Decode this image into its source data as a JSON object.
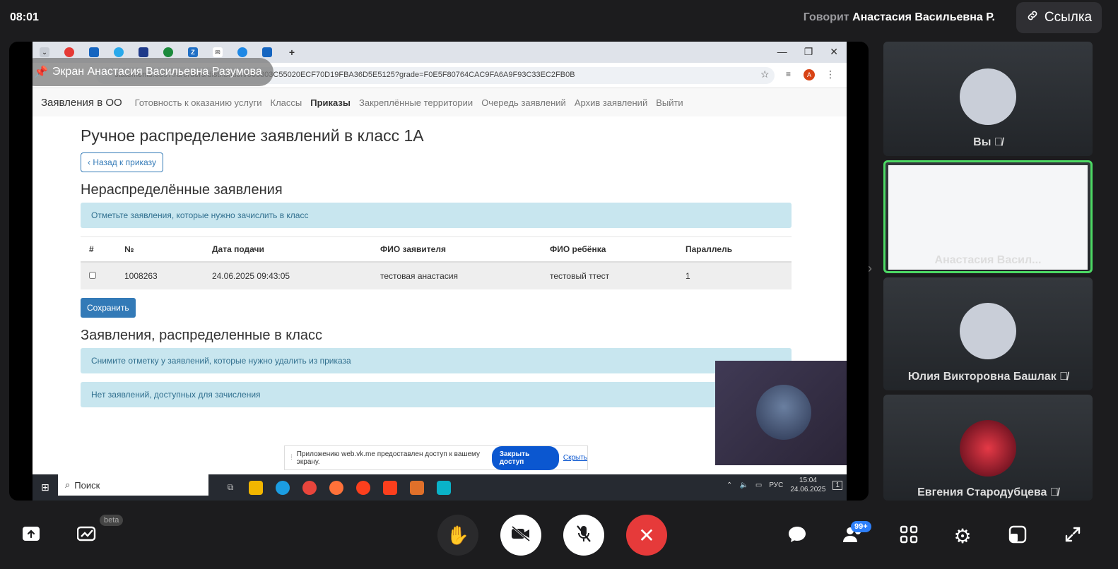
{
  "top": {
    "clock": "08:01",
    "speaker_prefix": "Говорит",
    "speaker_name": "Анастасия Васильевна Р.",
    "link_label": "Ссылка"
  },
  "shared_screen": {
    "label": "Экран Анастасия Васильевна Разумова",
    "url": "statements.ob57.ru/orders/distribution/065803C55020ECF70D19FBA36D5E5125?grade=F0E5F80764CAC9FA6A9F93C33EC2FB0B",
    "profile_initial": "A",
    "navbar": {
      "brand": "Заявления в ОО",
      "items": [
        "Готовность к оказанию услуги",
        "Классы",
        "Приказы",
        "Закреплённые территории",
        "Очередь заявлений",
        "Архив заявлений",
        "Выйти"
      ],
      "active_index": 2
    },
    "page": {
      "title": "Ручное распределение заявлений в класс 1А",
      "back_label": "Назад к приказу",
      "section1_title": "Нераспределённые заявления",
      "section1_alert": "Отметьте заявления, которые нужно зачислить в класс",
      "table": {
        "headers": [
          "#",
          "№",
          "Дата подачи",
          "ФИО заявителя",
          "ФИО ребёнка",
          "Параллель"
        ],
        "rows": [
          [
            "",
            "1008263",
            "24.06.2025 09:43:05",
            "тестовая анастасия",
            "тестовый ттест",
            "1"
          ]
        ]
      },
      "save_label": "Сохранить",
      "section2_title": "Заявления, распределенные в класс",
      "section2_alert": "Снимите отметку у заявлений, которые нужно удалить из приказа",
      "section2_empty": "Нет заявлений, доступных для зачисления"
    },
    "share_bar": {
      "text": "Приложению web.vk.me предоставлен доступ к вашему экрану.",
      "close_label": "Закрыть доступ",
      "hide_label": "Скрыть"
    },
    "taskbar": {
      "search_label": "Поиск",
      "lang": "РУС",
      "time": "15:04",
      "date": "24.06.2025",
      "notif_count": "1"
    }
  },
  "participants": [
    {
      "name": "Вы",
      "muted": true
    },
    {
      "name": "Анастасия Васил...",
      "muted": false,
      "speaking": true
    },
    {
      "name": "Юлия Викторовна Башлак",
      "muted": true
    },
    {
      "name": "Евгения Стародубцева",
      "muted": true
    }
  ],
  "toolbar": {
    "beta_label": "beta",
    "participants_badge": "99+"
  },
  "colors": {
    "background": "#1c1c1e",
    "accent_green": "#4cd964",
    "end_call": "#e63a3a",
    "link_blue": "#337ab7"
  }
}
